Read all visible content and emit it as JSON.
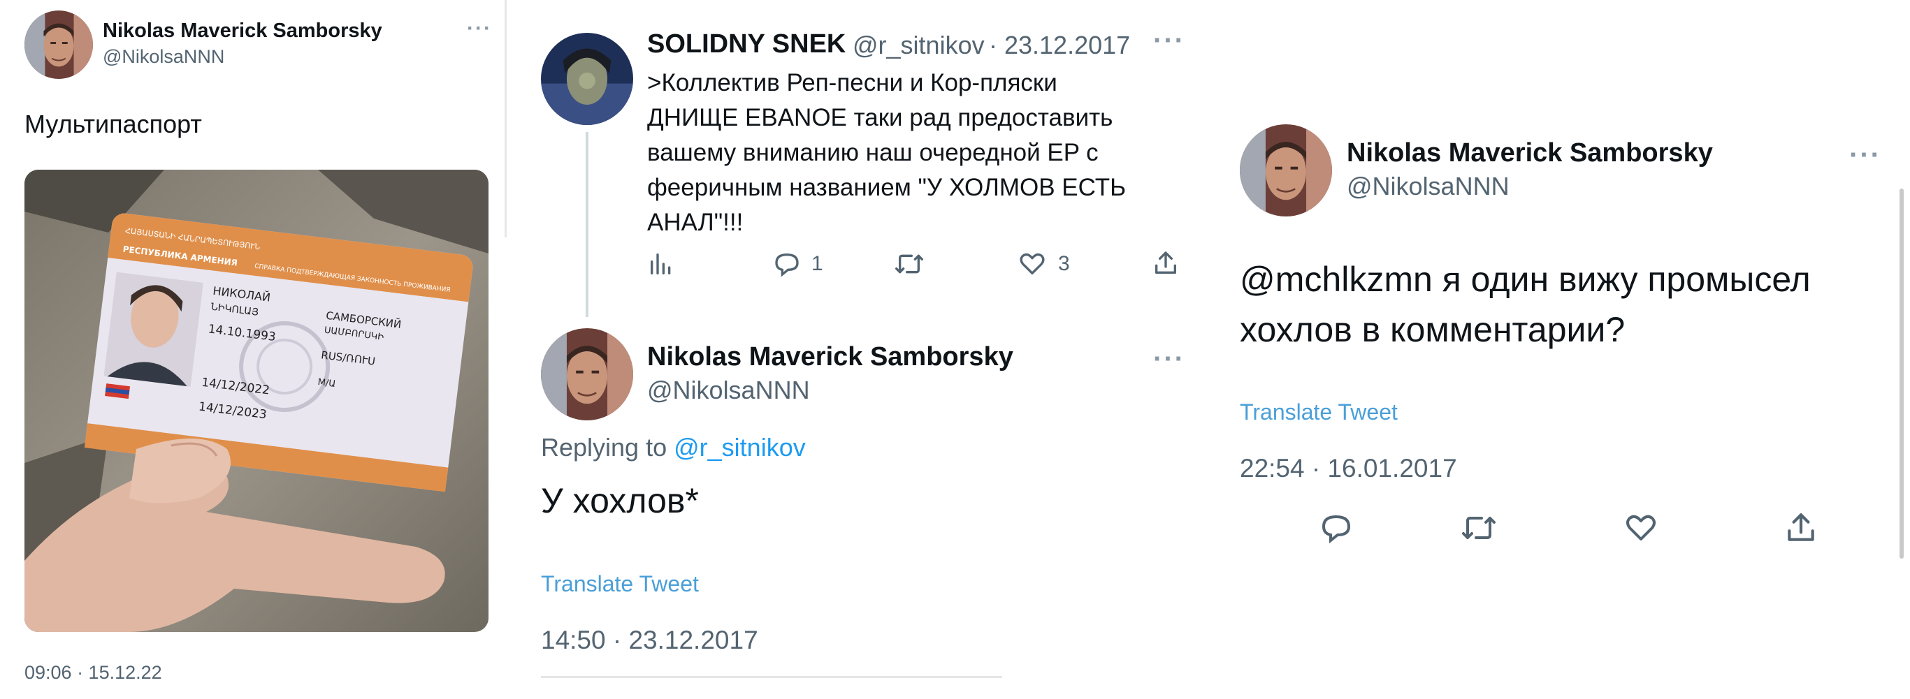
{
  "tweet1": {
    "author_name": "Nikolas Maverick Samborsky",
    "author_handle": "@NikolsaNNN",
    "more_label": "···",
    "text": "Мультипаспорт",
    "timestamp": "09:06 · 15.12.22",
    "photo": {
      "card_header": "ՀԱՅԱՍՏԱՆԻ ՀԱՆՐԱՊԵՏՈՒԹՅՈՒՆ",
      "card_country_ru": "РЕСПУБЛИКА АРМЕНИЯ",
      "card_title": "СПРАВКА ПОДТВЕРЖДАЮЩАЯ ЗАКОННОСТЬ ПРОЖИВАНИЯ",
      "given_name": "НИКОЛАЙ",
      "given_name_hy": "ՆԻԿՈԼԱՅ",
      "surname": "САМБОРСКИЙ",
      "surname_hy": "ՍԱՄԲՈՐՍԿԻ",
      "birth_date": "14.10.1993",
      "nationality": "RUS/ՌՈՒՍ",
      "sex": "M/Ա",
      "issue_date": "14/12/2022",
      "expiry_date": "14/12/2023"
    }
  },
  "tweet2": {
    "author_name": "SOLIDNY SNEK",
    "author_handle": "@r_sitnikov",
    "date": "· 23.12.2017",
    "more_label": "···",
    "lines": [
      ">Коллектив Реп-песни и Кор-пляски",
      "ДНИЩЕ EBANOE таки рад предоставить",
      "вашему вниманию наш очередной EP с",
      "фееричным названием \"У ХОЛМОВ ЕСТЬ",
      "АНАЛ\"!!!"
    ],
    "reply_count": "1",
    "like_count": "3"
  },
  "tweet3": {
    "author_name": "Nikolas Maverick Samborsky",
    "author_handle": "@NikolsaNNN",
    "more_label": "···",
    "replying_prefix": "Replying to",
    "replying_to": "@r_sitnikov",
    "text": "У хохлов*",
    "translate_label": "Translate Tweet",
    "timestamp": "14:50 · 23.12.2017"
  },
  "tweet4": {
    "author_name": "Nikolas Maverick Samborsky",
    "author_handle": "@NikolsaNNN",
    "more_label": "···",
    "mention": "@mchlkzmn",
    "text_rest": " я один вижу промысел",
    "text_line2": "хохлов в комментарии?",
    "translate_label": "Translate Tweet",
    "timestamp": "22:54 · 16.01.2017"
  },
  "icons": [
    "analytics-icon",
    "reply-icon",
    "retweet-icon",
    "like-icon",
    "share-icon",
    "more-icon"
  ],
  "colors": {
    "link": "#1d9bf0",
    "translate": "#4a9fd8",
    "muted": "#536471",
    "text": "#0f1419"
  }
}
